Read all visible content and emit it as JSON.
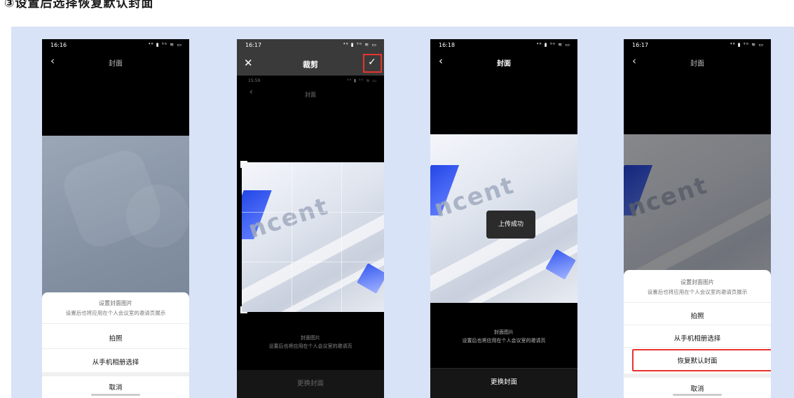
{
  "heading": "③设置后选择恢复默认封面",
  "status_icons": "⁴⁶ ▮ ⁵ᴳ ≋ ▭",
  "phone1": {
    "time": "16:16",
    "title": "封面",
    "sheet_title": "设置封面图片",
    "sheet_subtitle": "设置后也将应用在个人会议室的邀请页展示",
    "take_photo": "拍照",
    "choose_album": "从手机相册选择",
    "cancel": "取消"
  },
  "phone2": {
    "time": "16:17",
    "title": "裁剪",
    "inner_time": "15:59",
    "inner_title": "封面",
    "caption_title": "封面图片",
    "caption_subtitle": "设置后也将应用在个人会议室的邀请页",
    "change_cover": "更换封面",
    "image_word": "ncent"
  },
  "phone3": {
    "time": "16:18",
    "title": "封面",
    "toast": "上传成功",
    "caption_title": "封面图片",
    "caption_subtitle": "设置后也将应用在个人会议室的邀请页",
    "change_cover": "更换封面",
    "image_word": "ncent"
  },
  "phone4": {
    "time": "16:17",
    "title": "封面",
    "sheet_title": "设置封面图片",
    "sheet_subtitle": "设置后也将应用在个人会议室的邀请页展示",
    "take_photo": "拍照",
    "choose_album": "从手机相册选择",
    "restore_default": "恢复默认封面",
    "cancel": "取消",
    "image_word": "ncent"
  }
}
